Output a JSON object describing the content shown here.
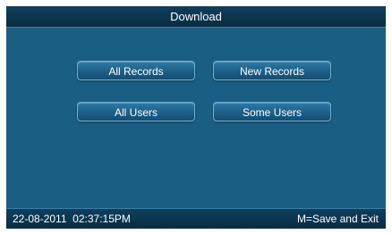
{
  "title": "Download",
  "buttons": {
    "all_records": "All Records",
    "new_records": "New Records",
    "all_users": "All Users",
    "some_users": "Some Users"
  },
  "status": {
    "datetime": "22-08-2011  02:37:15PM",
    "hint": "M=Save and Exit"
  },
  "colors": {
    "background": "#1b5e83",
    "bars": "#0a2c41",
    "button_border": "#6fb3d8"
  }
}
